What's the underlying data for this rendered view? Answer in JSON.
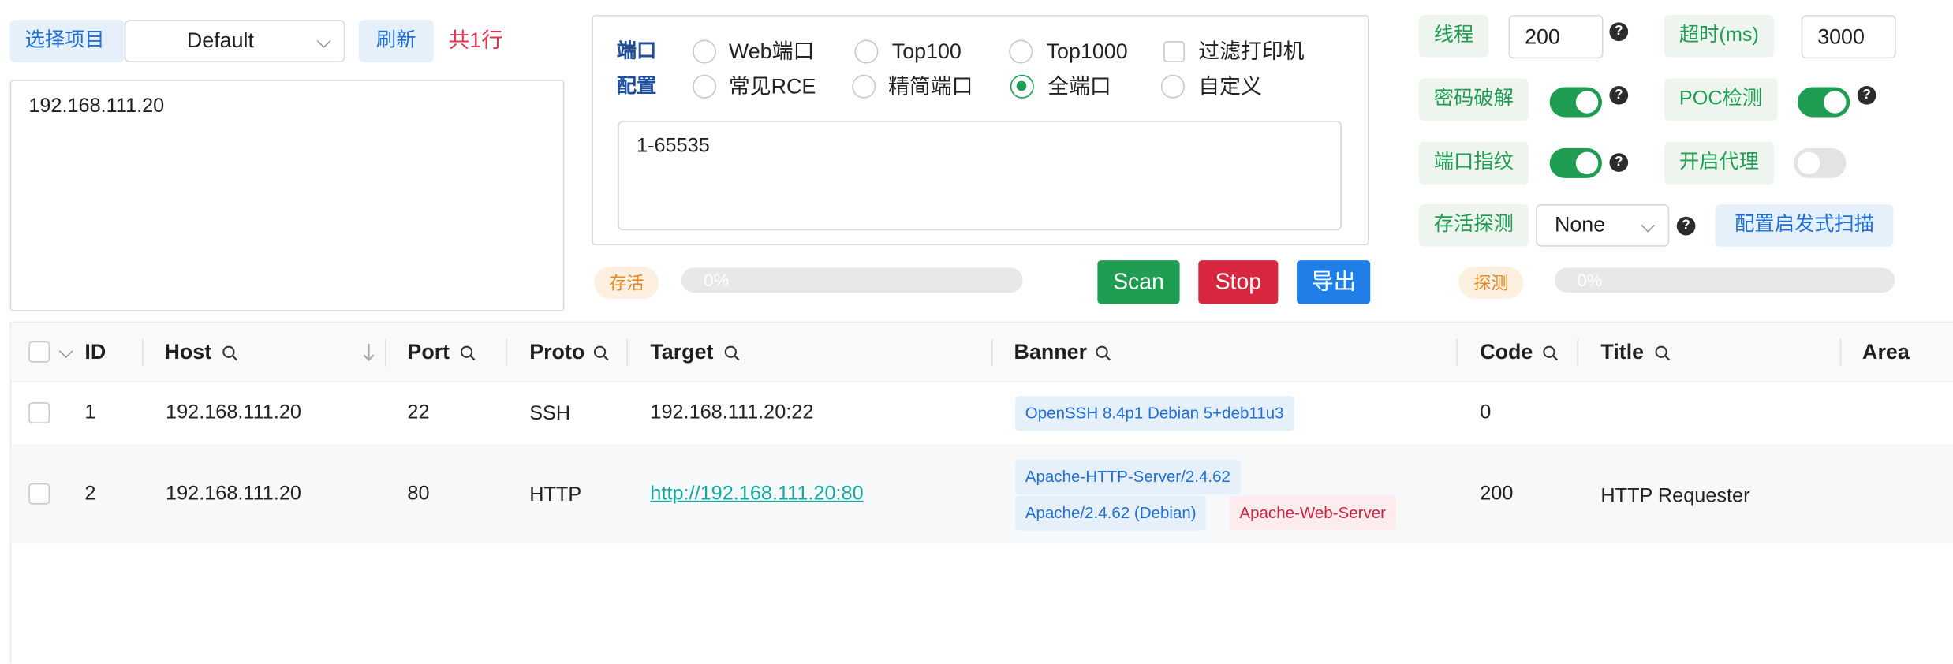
{
  "project": {
    "select_label": "选择项目",
    "selected": "Default",
    "refresh_label": "刷新",
    "line_count": "共1行",
    "targets_text": "192.168.111.20"
  },
  "ports": {
    "label_line1": "端口",
    "label_line2": "配置",
    "options": [
      {
        "label": "Web端口",
        "checked": false
      },
      {
        "label": "Top100",
        "checked": false
      },
      {
        "label": "Top1000",
        "checked": false
      },
      {
        "label": "常见RCE",
        "checked": false
      },
      {
        "label": "精简端口",
        "checked": false
      },
      {
        "label": "全端口",
        "checked": true
      },
      {
        "label": "自定义",
        "checked": false
      }
    ],
    "filter_printer_label": "过滤打印机",
    "filter_printer_checked": false,
    "port_range": "1-65535"
  },
  "progress": {
    "alive_label": "存活",
    "alive_value": 0,
    "alive_text": "0%",
    "detect_label": "探测",
    "detect_value": 0,
    "detect_text": "0%"
  },
  "actions": {
    "scan": "Scan",
    "stop": "Stop",
    "export": "导出"
  },
  "settings": {
    "threads_label": "线程",
    "threads_value": "200",
    "timeout_label": "超时(ms)",
    "timeout_value": "3000",
    "crack_label": "密码破解",
    "crack_on": true,
    "poc_label": "POC检测",
    "poc_on": true,
    "fingerprint_label": "端口指纹",
    "fingerprint_on": true,
    "proxy_label": "开启代理",
    "proxy_on": false,
    "alive_probe_label": "存活探测",
    "alive_probe_value": "None",
    "heuristic_button": "配置启发式扫描",
    "help_symbol": "?"
  },
  "table": {
    "columns": [
      "ID",
      "Host",
      "Port",
      "Proto",
      "Target",
      "Banner",
      "Code",
      "Title",
      "Area"
    ],
    "rows": [
      {
        "id": "1",
        "host": "192.168.111.20",
        "port": "22",
        "proto": "SSH",
        "target": "192.168.111.20:22",
        "banner": [
          "OpenSSH 8.4p1 Debian 5+deb11u3"
        ],
        "code": "0",
        "title": ""
      },
      {
        "id": "2",
        "host": "192.168.111.20",
        "port": "80",
        "proto": "HTTP",
        "target": "http://192.168.111.20:80",
        "banner": [
          "Apache-HTTP-Server/2.4.62",
          "Apache/2.4.62 (Debian)",
          "Apache-Web-Server"
        ],
        "code": "200",
        "title": "HTTP Requester"
      }
    ]
  },
  "colors": {
    "accent_green": "#1f9d52",
    "accent_blue": "#1f6fd6",
    "scan_button": "#1f9d52",
    "stop_button": "#d7263d",
    "export_button": "#1f7fe6",
    "count_red": "#e0344f",
    "link_teal": "#17a8a0"
  }
}
